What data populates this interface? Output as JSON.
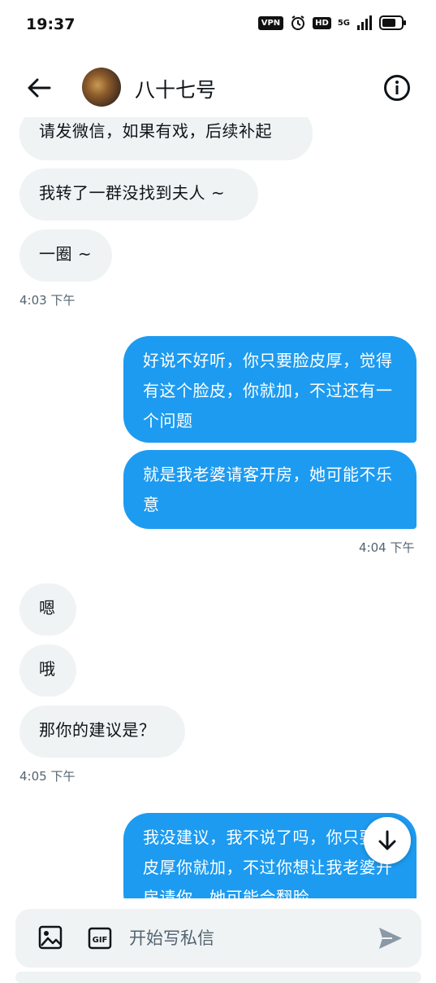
{
  "status_bar": {
    "time": "19:37",
    "vpn_label": "VPN",
    "hd_label": "HD",
    "network_label": "5G",
    "icons": [
      "alarm-icon",
      "signal-icon",
      "battery-icon"
    ]
  },
  "header": {
    "contact_name": "八十七号",
    "icons": [
      "back-arrow-icon",
      "avatar",
      "info-icon"
    ]
  },
  "messages": [
    {
      "direction": "in",
      "text": "请发微信，如果有戏，后续补起"
    },
    {
      "direction": "in",
      "text": "我转了一群没找到夫人 ~"
    },
    {
      "direction": "in",
      "text": "一圈 ~"
    },
    {
      "type": "timestamp",
      "text": "4:03 下午"
    },
    {
      "direction": "out",
      "text": "好说不好听，你只要脸皮厚，觉得有这个脸皮，你就加，不过还有一个问题"
    },
    {
      "direction": "out",
      "text": "就是我老婆请客开房，她可能不乐意"
    },
    {
      "type": "timestamp",
      "text": "4:04 下午"
    },
    {
      "direction": "in",
      "text": "嗯"
    },
    {
      "direction": "in",
      "text": "哦"
    },
    {
      "direction": "in",
      "text": "那你的建议是？"
    },
    {
      "type": "timestamp",
      "text": "4:05 下午"
    },
    {
      "direction": "out",
      "text": "我没建议，我不说了吗，你只要脸皮厚你就加，不过你想让我老婆开房请你，她可能会翻脸"
    }
  ],
  "composer": {
    "placeholder": "开始写私信",
    "icons": [
      "image-icon",
      "gif-icon",
      "send-icon",
      "scroll-down-arrow-icon"
    ]
  },
  "colors": {
    "outgoing_bubble": "#1d9bf0",
    "incoming_bubble": "#eff3f4",
    "timestamp": "#536471"
  }
}
